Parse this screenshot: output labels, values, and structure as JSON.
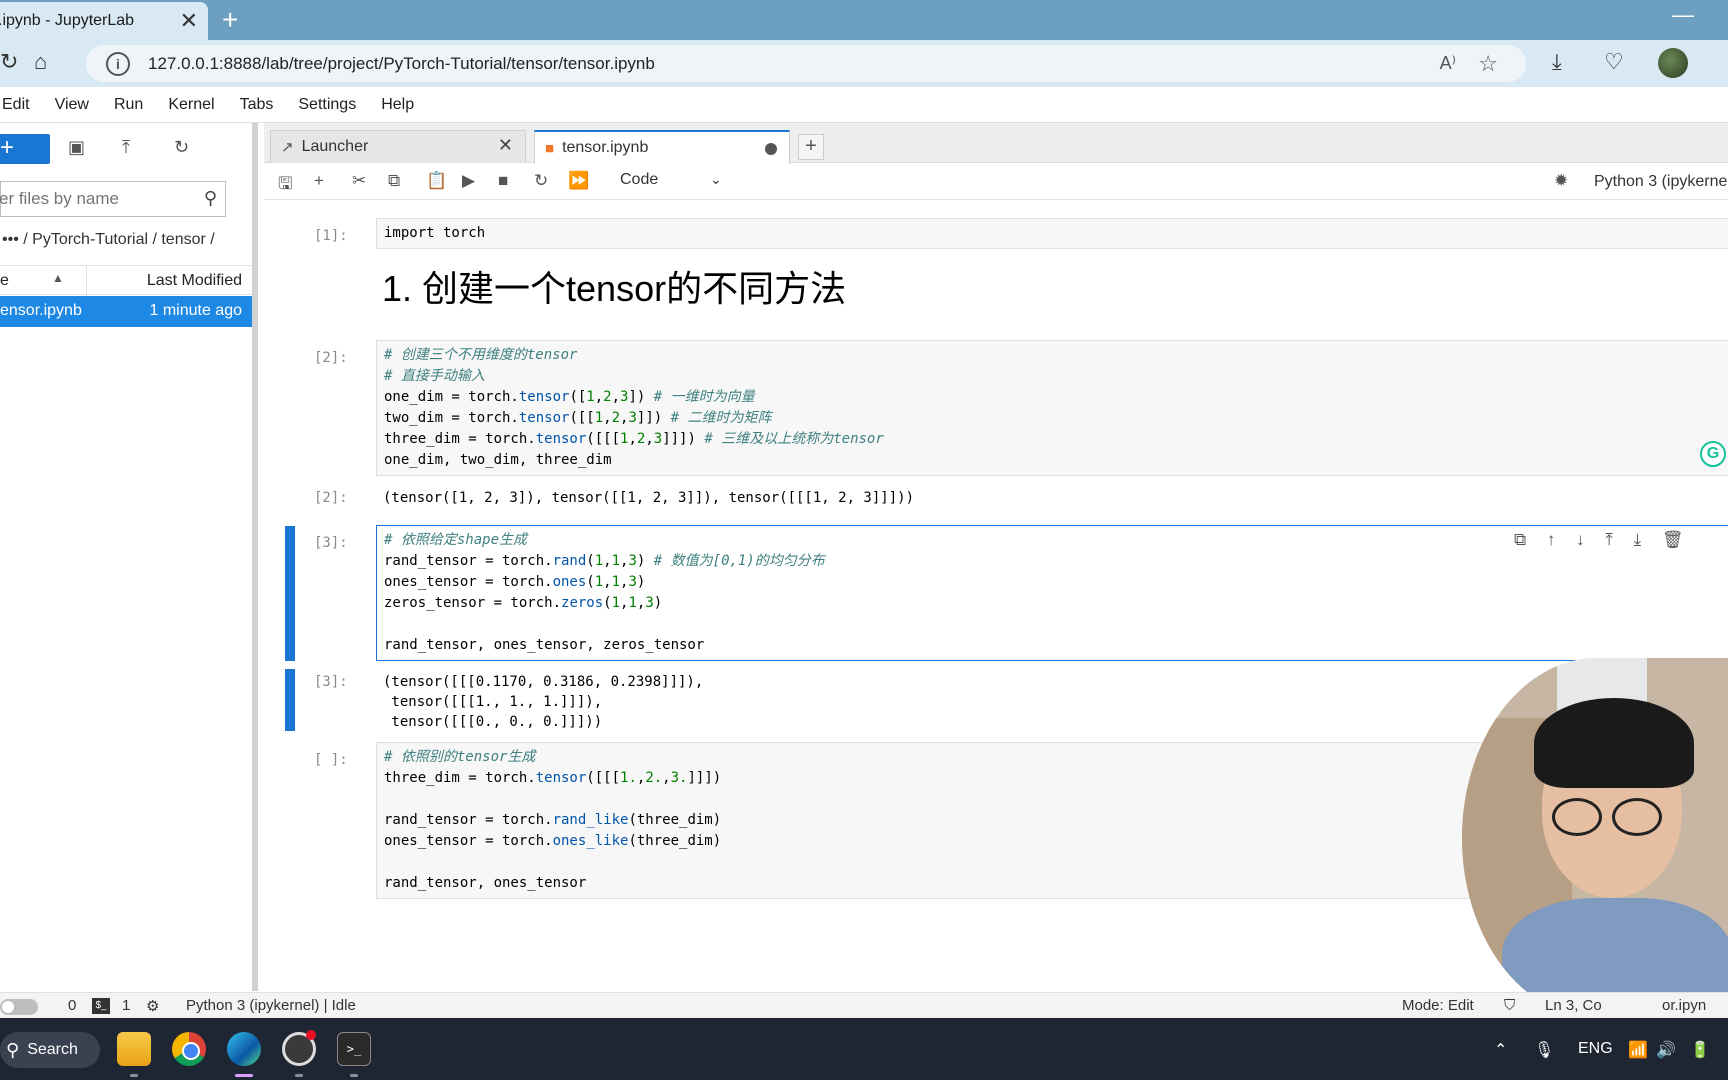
{
  "browser": {
    "tab_title": ".ipynb - JupyterLab",
    "url": "127.0.0.1:8888/lab/tree/project/PyTorch-Tutorial/tensor/tensor.ipynb"
  },
  "menu": [
    "Edit",
    "View",
    "Run",
    "Kernel",
    "Tabs",
    "Settings",
    "Help"
  ],
  "filebrowser": {
    "new_label": "+",
    "filter_placeholder": "er files by name",
    "breadcrumb": "••• / PyTorch-Tutorial / tensor /",
    "col_name": "e",
    "col_modified": "Last Modified",
    "file_name": "ensor.ipynb",
    "file_modified": "1 minute ago"
  },
  "tabs": [
    {
      "label": "Launcher"
    },
    {
      "label": "tensor.ipynb"
    }
  ],
  "notebook_toolbar": {
    "cell_type": "Code",
    "kernel": "Python 3 (ipykerne"
  },
  "cells": {
    "c1_prompt": "[1]:",
    "c1_code": "import torch",
    "heading": "1. 创建一个tensor的不同方法",
    "c2_prompt": "[2]:",
    "c2_out_prompt": "[2]:",
    "c2_output": "(tensor([1, 2, 3]), tensor([[1, 2, 3]]), tensor([[[1, 2, 3]]]))",
    "c3_prompt": "[3]:",
    "c3_out_prompt": "[3]:",
    "c3_output": "(tensor([[[0.1170, 0.3186, 0.2398]]]),\n tensor([[[1., 1., 1.]]]),\n tensor([[[0., 0., 0.]]]))",
    "c4_prompt": "[ ]:"
  },
  "statusbar": {
    "count0": "0",
    "count1": "1",
    "kernel_status": "Python 3 (ipykernel) | Idle",
    "mode": "Mode: Edit",
    "position": "Ln 3, Co",
    "file": "or.ipyn"
  },
  "taskbar": {
    "search": "Search",
    "lang": "ENG"
  }
}
